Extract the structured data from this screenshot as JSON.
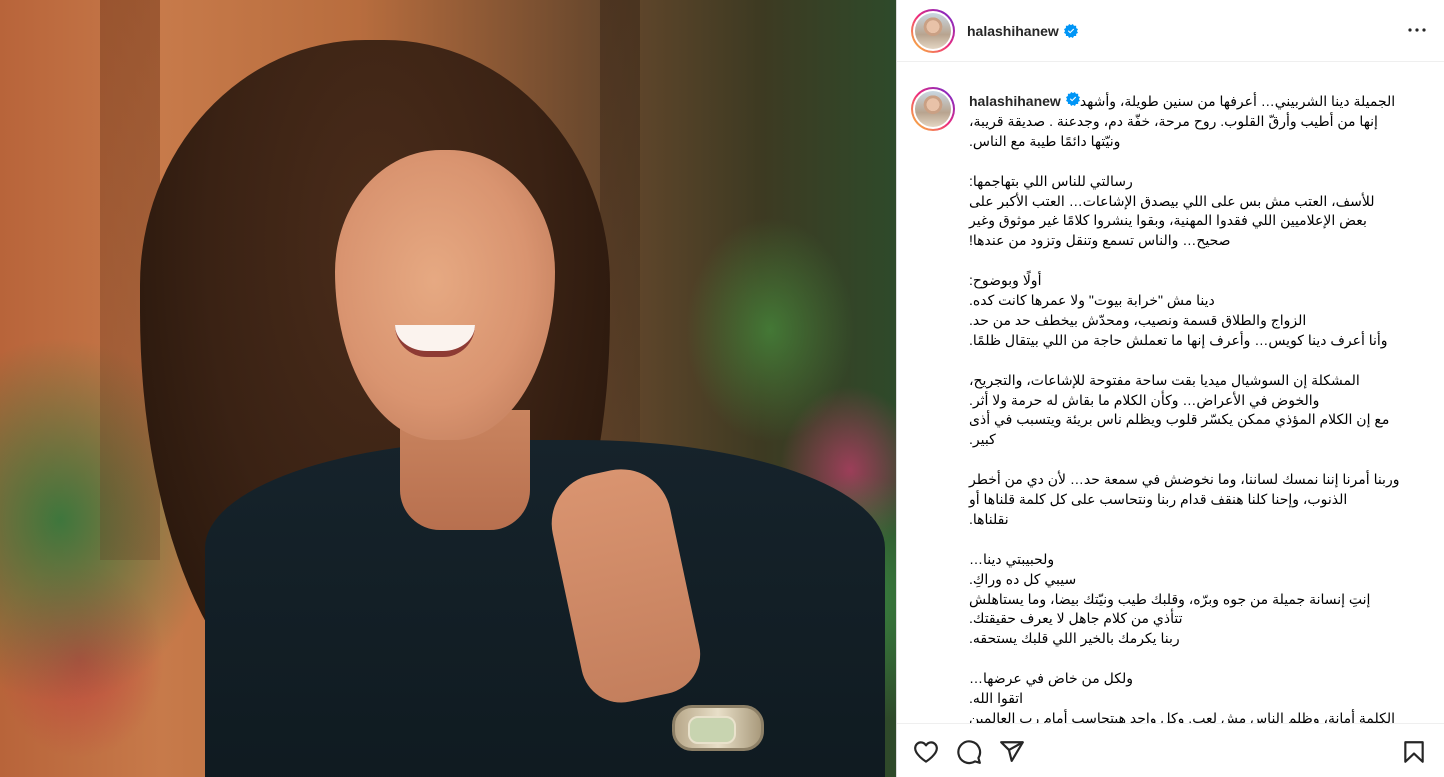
{
  "post": {
    "username": "halashihanew",
    "verified": true,
    "image_alt": "",
    "caption_lines": [
      "الجميلة دينا الشربيني… أعرفها من سنين طويلة، وأشهد",
      "إنها من أطيب وأرقّ القلوب. روح مرحة، خفّة دم، وجدعنة . صديقة قريبة،",
      "ونيّتها دائمًا طيبة مع الناس.",
      "",
      "رسالتي للناس اللي بتهاجمها:",
      "للأسف، العتب مش بس على اللي بيصدق الإشاعات… العتب الأكبر على",
      "بعض الإعلاميين اللي فقدوا المهنية، وبقوا ينشروا كلامًا غير موثوق وغير",
      "صحيح… والناس تسمع وتنقل وتزود من عندها!",
      "",
      "أولًا وبوضوح:",
      "دينا مش \"خرابة بيوت\" ولا عمرها كانت كده.",
      "الزواج والطلاق قسمة ونصيب، ومحدّش بيخطف حد من حد.",
      "وأنا أعرف دينا كويس… وأعرف إنها ما تعملش حاجة من اللي بيتقال ظلمًا.",
      "",
      "المشكلة إن السوشيال ميديا بقت ساحة مفتوحة للإشاعات، والتجريح،",
      "والخوض في الأعراض… وكأن الكلام ما بقاش له حرمة ولا أثر.",
      "مع إن الكلام المؤذي ممكن يكسّر قلوب ويظلم ناس بريئة ويتسبب في أذى",
      "كبير.",
      "",
      "وربنا أمرنا إننا نمسك لساننا، وما نخوضش في سمعة حد… لأن دي من أخطر",
      "الذنوب، وإحنا كلنا هنقف قدام ربنا ونتحاسب على كل كلمة قلناها أو",
      "نقلناها.",
      "",
      "ولحبيبتي دينا…",
      "سيبي كل ده وراكِ.",
      "إنتِ إنسانة جميلة من جوه وبرّه، وقلبك طيب ونيّتك بيضا، وما يستاهلش",
      "تتأذي من كلام جاهل لا يعرف حقيقتك.",
      "ربنا يكرمك بالخير اللي قلبك يستحقه.",
      "",
      "ولكل من خاض في عرضها…",
      "اتقوا الله.",
      "الكلمة أمانة، وظلم الناس مش لعب. وكل واحد هيتحاسب أمام رب العالمين"
    ]
  },
  "icons": {
    "more": "more-options-icon",
    "like": "heart-icon",
    "comment": "comment-icon",
    "share": "share-icon",
    "save": "bookmark-icon",
    "verified": "verified-badge-icon"
  },
  "colors": {
    "verified_blue": "#0095f6",
    "border": "#dbdbdb",
    "text": "#000000"
  }
}
